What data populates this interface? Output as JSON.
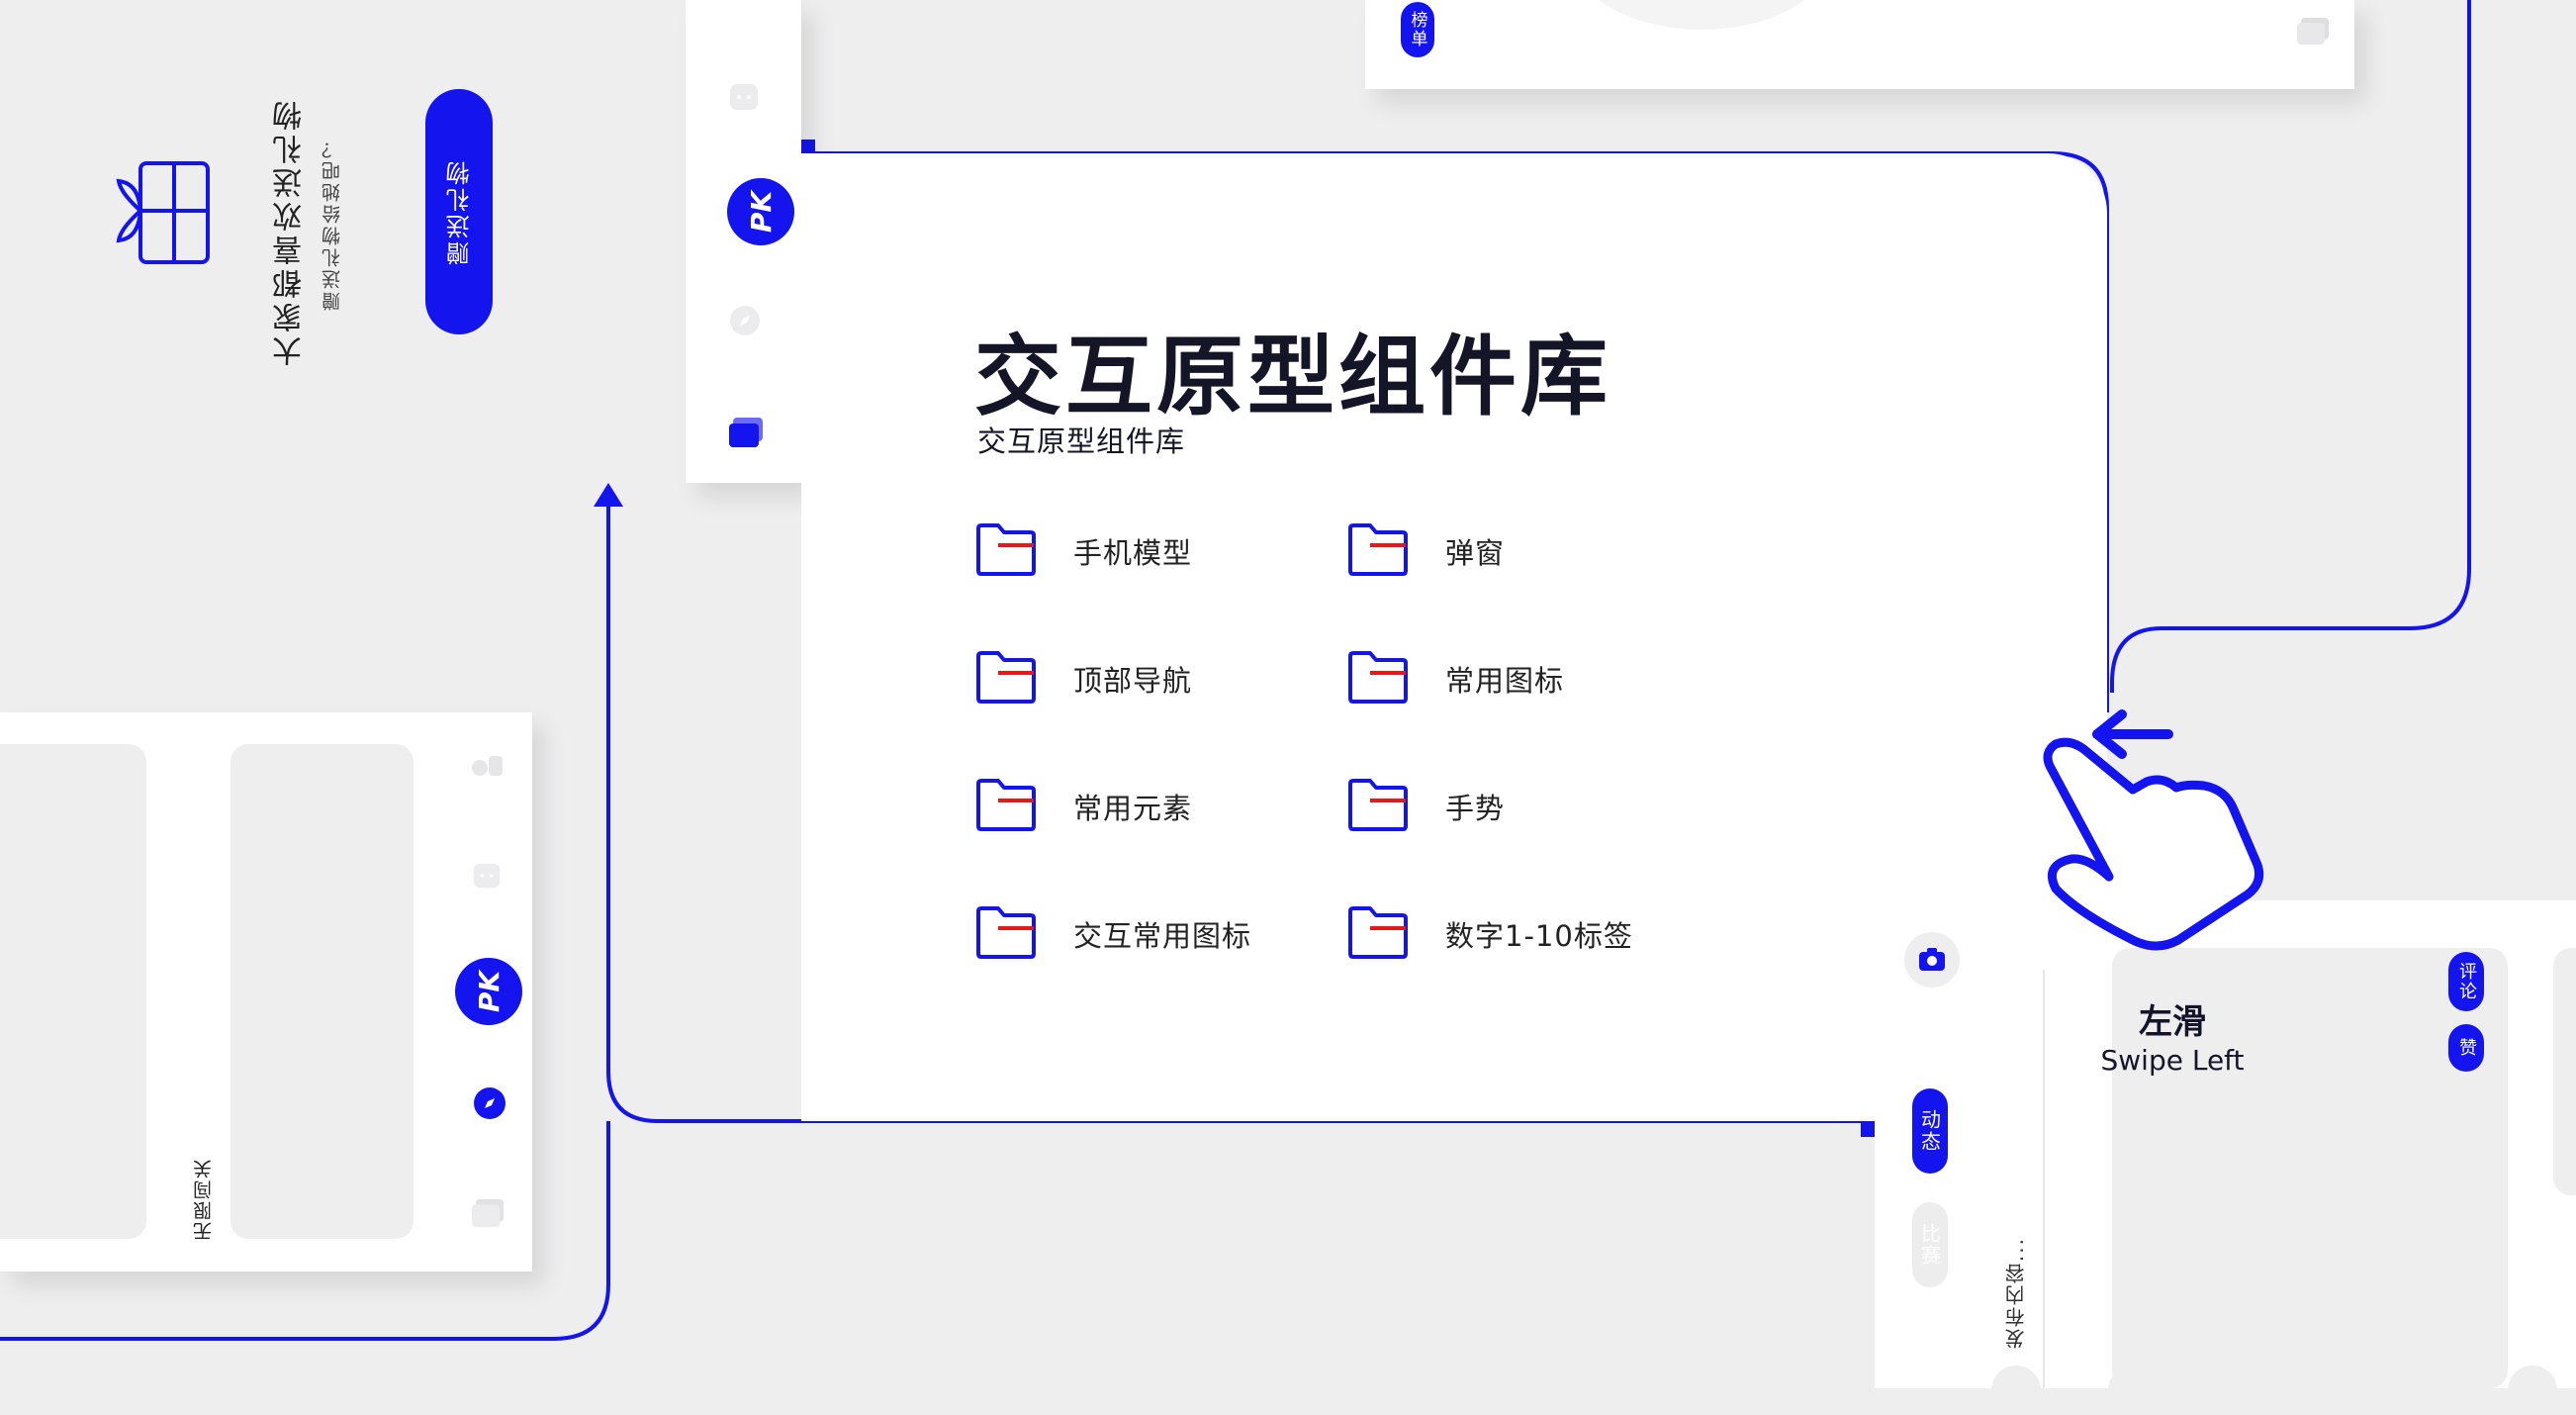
{
  "main": {
    "title": "交互原型组件库",
    "subtitle": "交互原型组件库",
    "items": [
      {
        "label": "手机模型"
      },
      {
        "label": "弹窗"
      },
      {
        "label": "顶部导航"
      },
      {
        "label": "常用图标"
      },
      {
        "label": "常用元素"
      },
      {
        "label": "手势"
      },
      {
        "label": "交互常用图标"
      },
      {
        "label": "数字1-10标签"
      }
    ]
  },
  "gift_card": {
    "heading": "大家都喜欢送礼物",
    "subheading": "赠送礼物给她吧？",
    "button": "赠送礼物"
  },
  "top_card": {
    "tag": "榜单"
  },
  "left_screen": {
    "caption": "无限闯关"
  },
  "swipe_demo": {
    "title": "左滑",
    "subtitle": "Swipe Left"
  },
  "right_screen": {
    "tab_active": "动态",
    "tab_inactive": "比赛",
    "placeholder": "发布内容...",
    "tag_comment": "评论",
    "tag_like": "赞"
  },
  "icons": {
    "gift": "gift-icon",
    "folder": "folder-icon",
    "hand": "hand-pointer-icon",
    "arrow": "arrow-left-icon",
    "pk_badge": "pk-icon",
    "compass": "compass-icon",
    "chat": "chat-icon",
    "cards": "cards-icon",
    "user": "user-icon",
    "camera": "camera-icon"
  },
  "colors": {
    "accent": "#1414ee",
    "folder_stripe": "#e81818",
    "background": "#eeeeef",
    "surface": "#ffffff",
    "text": "#151528"
  }
}
